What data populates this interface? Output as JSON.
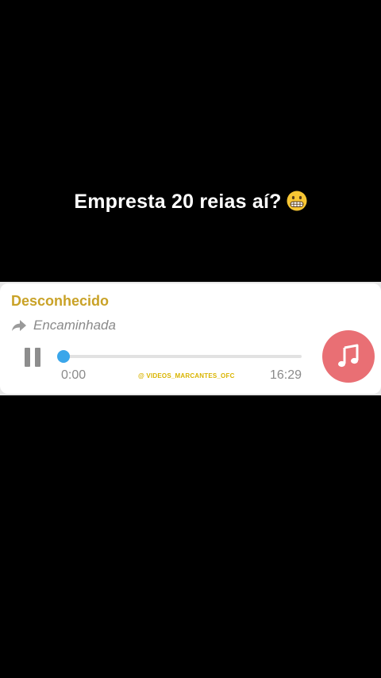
{
  "caption": {
    "text": "Empresta 20 reias aí?",
    "emoji": "grimacing-face-icon"
  },
  "message": {
    "sender": "Desconhecido",
    "forwarded_label": "Encaminhada",
    "forward_icon": "forward-arrow-icon",
    "audio": {
      "state_icon": "pause-icon",
      "current_time": "0:00",
      "total_time": "16:29",
      "progress": 0.0,
      "file_icon": "music-note-icon"
    },
    "watermark": "@ VIDEOS_MARCANTES_OFC"
  },
  "colors": {
    "background": "#000000",
    "sender": "#c9a227",
    "progress_thumb": "#3aa6ea",
    "music_button": "#e96f74",
    "watermark": "#d9b400"
  }
}
